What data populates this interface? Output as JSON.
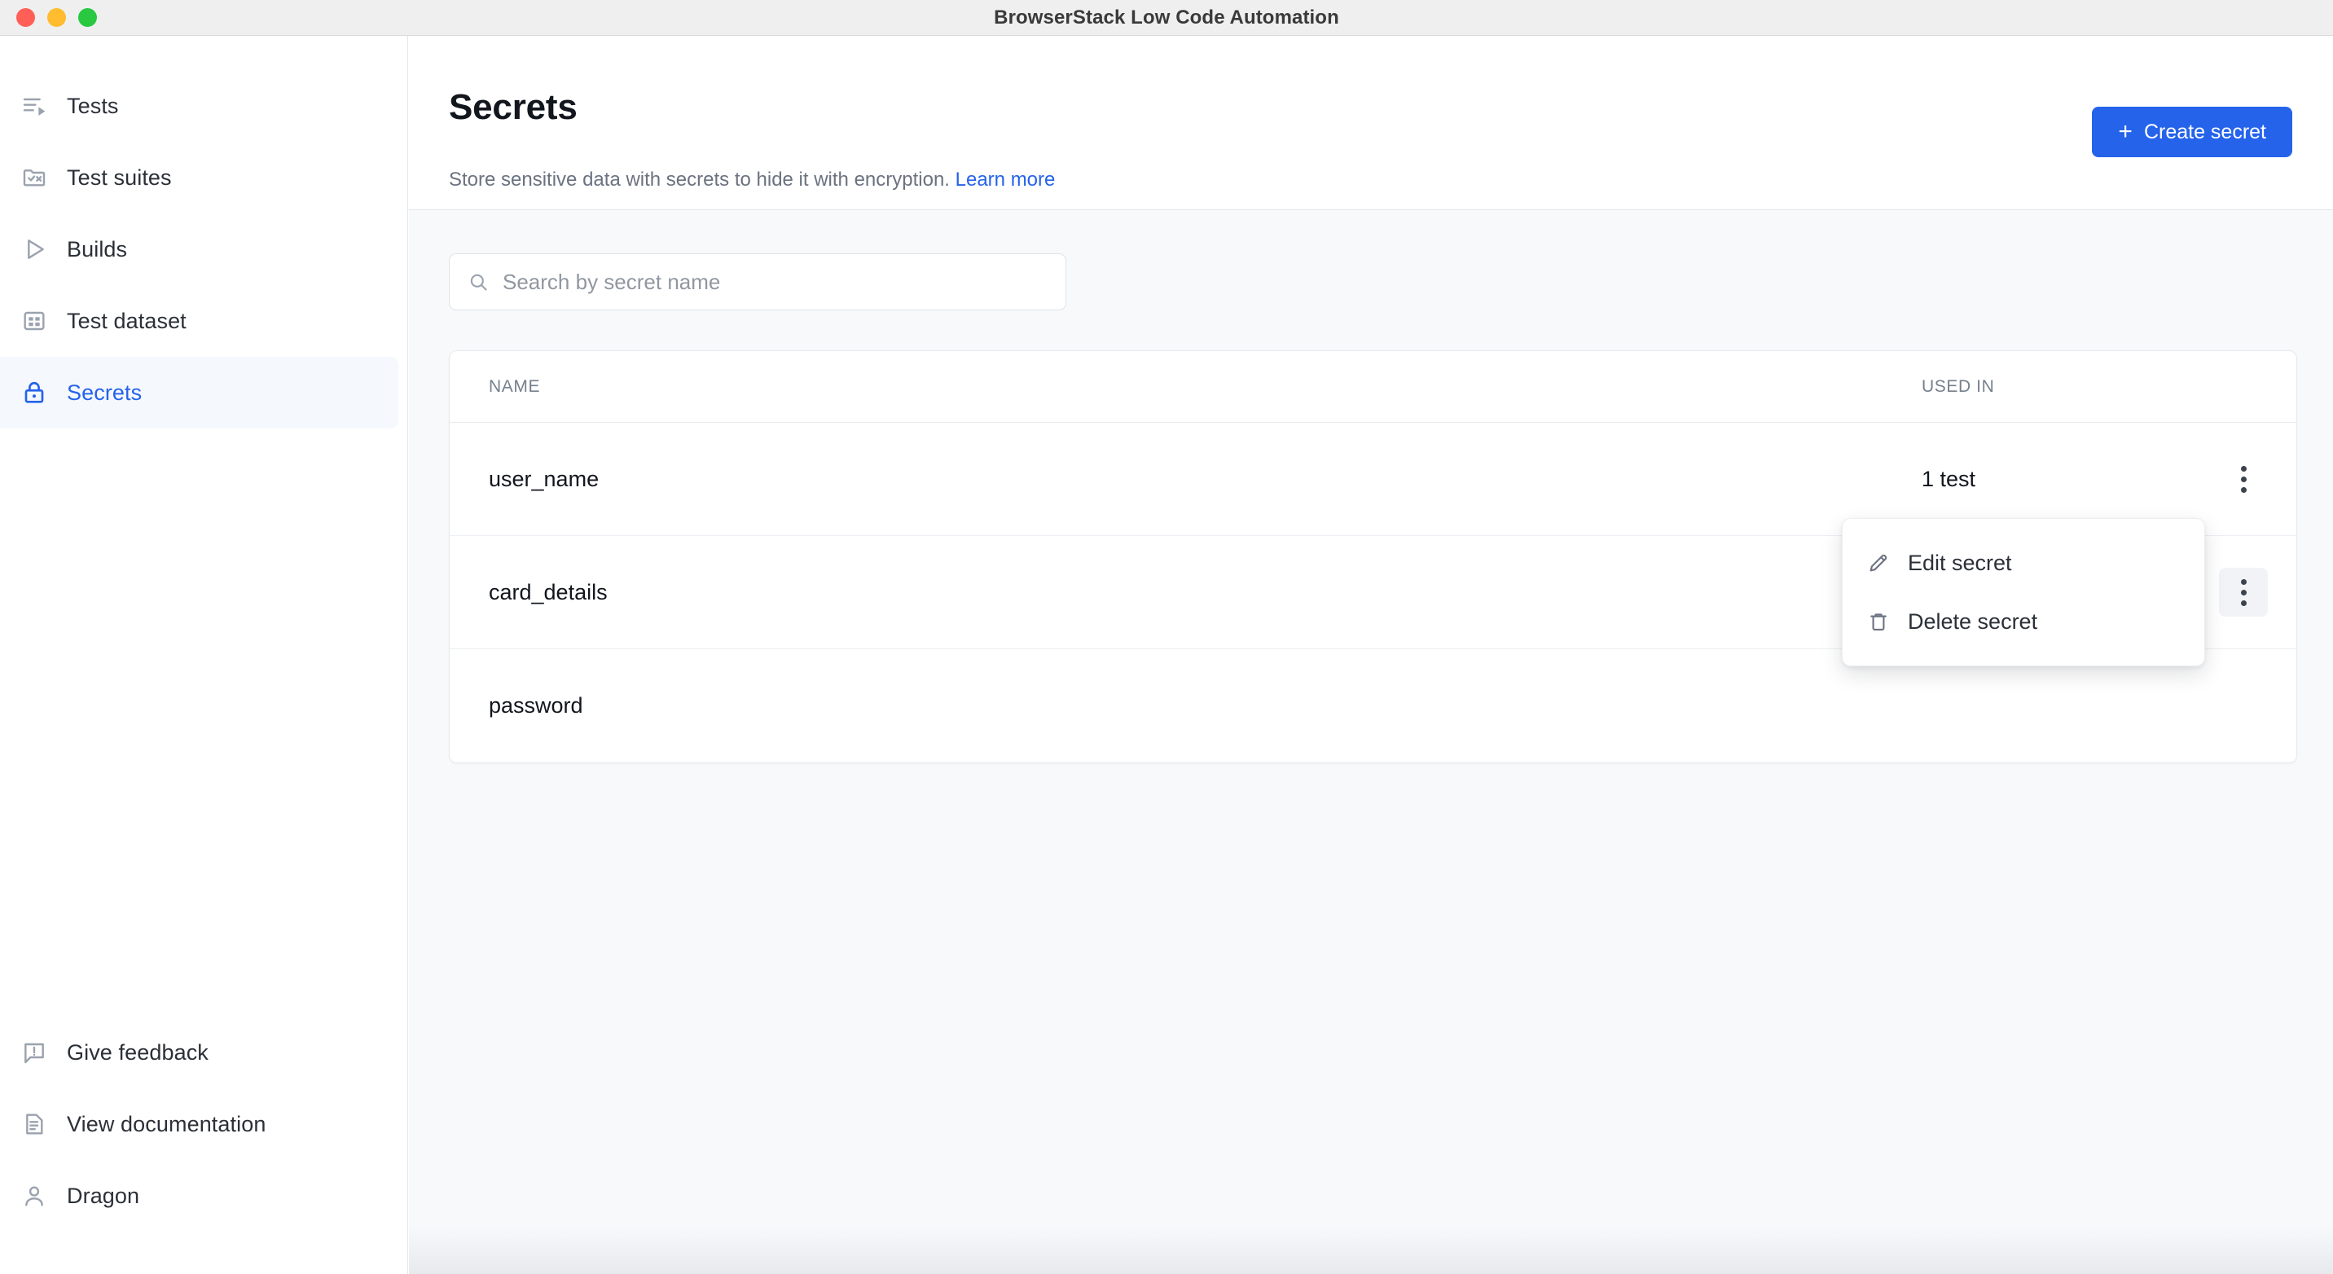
{
  "window": {
    "title": "BrowserStack Low Code Automation",
    "traffic_lights": [
      "close",
      "minimize",
      "zoom"
    ]
  },
  "sidebar": {
    "top_items": [
      {
        "label": "Tests",
        "icon": "tests-icon",
        "active": false
      },
      {
        "label": "Test suites",
        "icon": "test-suites-icon",
        "active": false
      },
      {
        "label": "Builds",
        "icon": "builds-icon",
        "active": false
      },
      {
        "label": "Test dataset",
        "icon": "test-dataset-icon",
        "active": false
      },
      {
        "label": "Secrets",
        "icon": "lock-icon",
        "active": true
      }
    ],
    "bottom_items": [
      {
        "label": "Give feedback",
        "icon": "feedback-icon"
      },
      {
        "label": "View documentation",
        "icon": "document-icon"
      },
      {
        "label": "Dragon",
        "icon": "user-icon"
      }
    ]
  },
  "header": {
    "title": "Secrets",
    "subtitle": "Store sensitive data with secrets to hide it with encryption.",
    "learn_more": "Learn more",
    "create_button": "Create secret",
    "create_button_icon": "plus-icon"
  },
  "search": {
    "placeholder": "Search by secret name",
    "value": "",
    "icon": "search-icon"
  },
  "table": {
    "columns": [
      "NAME",
      "USED IN"
    ],
    "rows": [
      {
        "name": "user_name",
        "used_in": "1 test"
      },
      {
        "name": "card_details",
        "used_in": "-"
      },
      {
        "name": "password",
        "used_in": ""
      }
    ]
  },
  "dropdown": {
    "open_for_row": "card_details",
    "items": [
      {
        "label": "Edit secret",
        "icon": "pencil-icon"
      },
      {
        "label": "Delete secret",
        "icon": "trash-icon"
      }
    ]
  },
  "colors": {
    "accent": "#2563eb",
    "page_bg": "#f7f9fb",
    "text_primary": "#12161d",
    "text_muted": "#6b7280"
  }
}
